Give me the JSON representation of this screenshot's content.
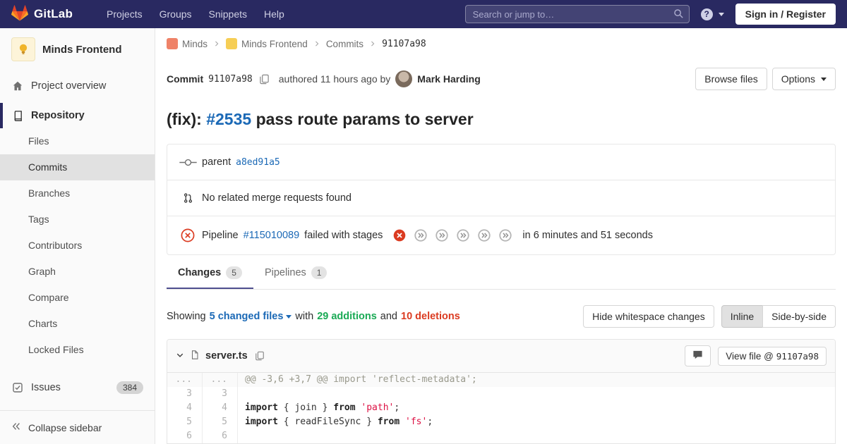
{
  "colors": {
    "navbar_bg": "#292961",
    "link": "#1b69b6",
    "additions_green": "#1aaa55",
    "deletions_red": "#db3b21",
    "failed_red": "#db3b21"
  },
  "navbar": {
    "brand": "GitLab",
    "menu": [
      "Projects",
      "Groups",
      "Snippets",
      "Help"
    ],
    "search_placeholder": "Search or jump to…",
    "sign_in_label": "Sign in / Register"
  },
  "sidebar": {
    "project_name": "Minds Frontend",
    "overview_label": "Project overview",
    "repository_label": "Repository",
    "repository_items": [
      "Files",
      "Commits",
      "Branches",
      "Tags",
      "Contributors",
      "Graph",
      "Compare",
      "Charts",
      "Locked Files"
    ],
    "active_item": "Commits",
    "issues_label": "Issues",
    "issues_count": "384",
    "collapse_label": "Collapse sidebar"
  },
  "breadcrumb": {
    "items": [
      "Minds",
      "Minds Frontend",
      "Commits",
      "91107a98"
    ]
  },
  "commit": {
    "label": "Commit",
    "sha": "91107a98",
    "authored_text": "authored 11 hours ago by",
    "author": "Mark Harding",
    "browse_files_label": "Browse files",
    "options_label": "Options",
    "title_prefix": "(fix): ",
    "title_issue": "#2535",
    "title_suffix": " pass route params to server"
  },
  "parent": {
    "label": "parent",
    "sha": "a8ed91a5"
  },
  "merge_requests": {
    "text": "No related merge requests found"
  },
  "pipeline": {
    "label": "Pipeline",
    "id": "#115010089",
    "status_text": "failed with stages",
    "duration_text": "in 6 minutes and 51 seconds",
    "stages": [
      "failed",
      "skipped",
      "skipped",
      "skipped",
      "skipped",
      "skipped"
    ]
  },
  "tabs": {
    "changes_label": "Changes",
    "changes_count": "5",
    "pipelines_label": "Pipelines",
    "pipelines_count": "1"
  },
  "summary": {
    "showing": "Showing",
    "changed_files": "5 changed files",
    "with_text": "with",
    "additions_text": "29 additions",
    "and_text": "and",
    "deletions_text": "10 deletions",
    "hide_whitespace": "Hide whitespace changes",
    "inline": "Inline",
    "side_by_side": "Side-by-side"
  },
  "diff_file": {
    "name": "server.ts",
    "view_file_label": "View file @",
    "view_file_sha": "91107a98",
    "hunk": {
      "old": "...",
      "new": "...",
      "text": "@@ -3,6 +3,7 @@ import 'reflect-metadata';"
    },
    "lines": [
      {
        "old": "3",
        "new": "3",
        "tokens": []
      },
      {
        "old": "4",
        "new": "4",
        "tokens": [
          {
            "t": "kw",
            "v": "import"
          },
          {
            "t": "pl",
            "v": " { join } "
          },
          {
            "t": "kw",
            "v": "from"
          },
          {
            "t": "pl",
            "v": " "
          },
          {
            "t": "str",
            "v": "'path'"
          },
          {
            "t": "pl",
            "v": ";"
          }
        ]
      },
      {
        "old": "5",
        "new": "5",
        "tokens": [
          {
            "t": "kw",
            "v": "import"
          },
          {
            "t": "pl",
            "v": " { readFileSync } "
          },
          {
            "t": "kw",
            "v": "from"
          },
          {
            "t": "pl",
            "v": " "
          },
          {
            "t": "str",
            "v": "'fs'"
          },
          {
            "t": "pl",
            "v": ";"
          }
        ]
      },
      {
        "old": "6",
        "new": "6",
        "tokens": []
      }
    ]
  }
}
